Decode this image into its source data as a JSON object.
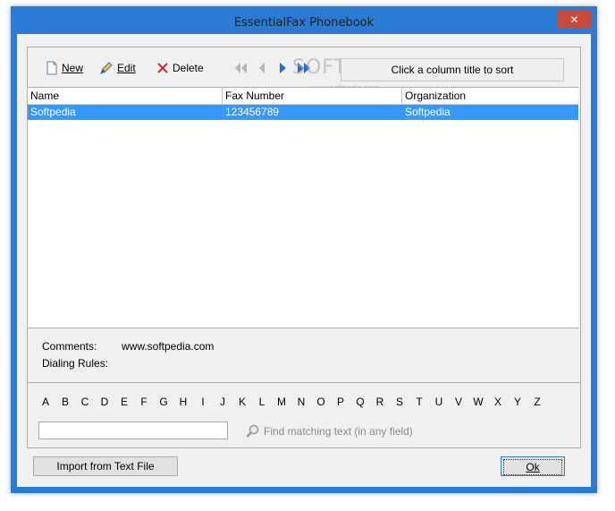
{
  "window": {
    "title": "EssentialFax Phonebook",
    "close_glyph": "✕"
  },
  "toolbar": {
    "new_label": "New",
    "edit_label": "Edit",
    "delete_label": "Delete",
    "sort_hint": "Click a column title to sort",
    "watermark": "SOFTPEDIA",
    "watermark_url": "www.softpedia.com"
  },
  "table": {
    "columns": [
      "Name",
      "Fax Number",
      "Organization"
    ],
    "rows": [
      {
        "name": "Softpedia",
        "fax": "123456789",
        "organization": "Softpedia",
        "selected": true
      }
    ]
  },
  "details": {
    "comments_label": "Comments:",
    "comments_value": "www.softpedia.com",
    "dialing_label": "Dialing Rules:",
    "dialing_value": ""
  },
  "alphabet": [
    "A",
    "B",
    "C",
    "D",
    "E",
    "F",
    "G",
    "H",
    "I",
    "J",
    "K",
    "L",
    "M",
    "N",
    "O",
    "P",
    "Q",
    "R",
    "S",
    "T",
    "U",
    "V",
    "W",
    "X",
    "Y",
    "Z"
  ],
  "search": {
    "value": "",
    "hint": "Find matching text (in any field)"
  },
  "buttons": {
    "import_label": "Import from Text File",
    "ok_label": "Ok"
  },
  "colors": {
    "titlebar": "#2a7bd3",
    "selection": "#3399ff",
    "close": "#c74b3c"
  }
}
